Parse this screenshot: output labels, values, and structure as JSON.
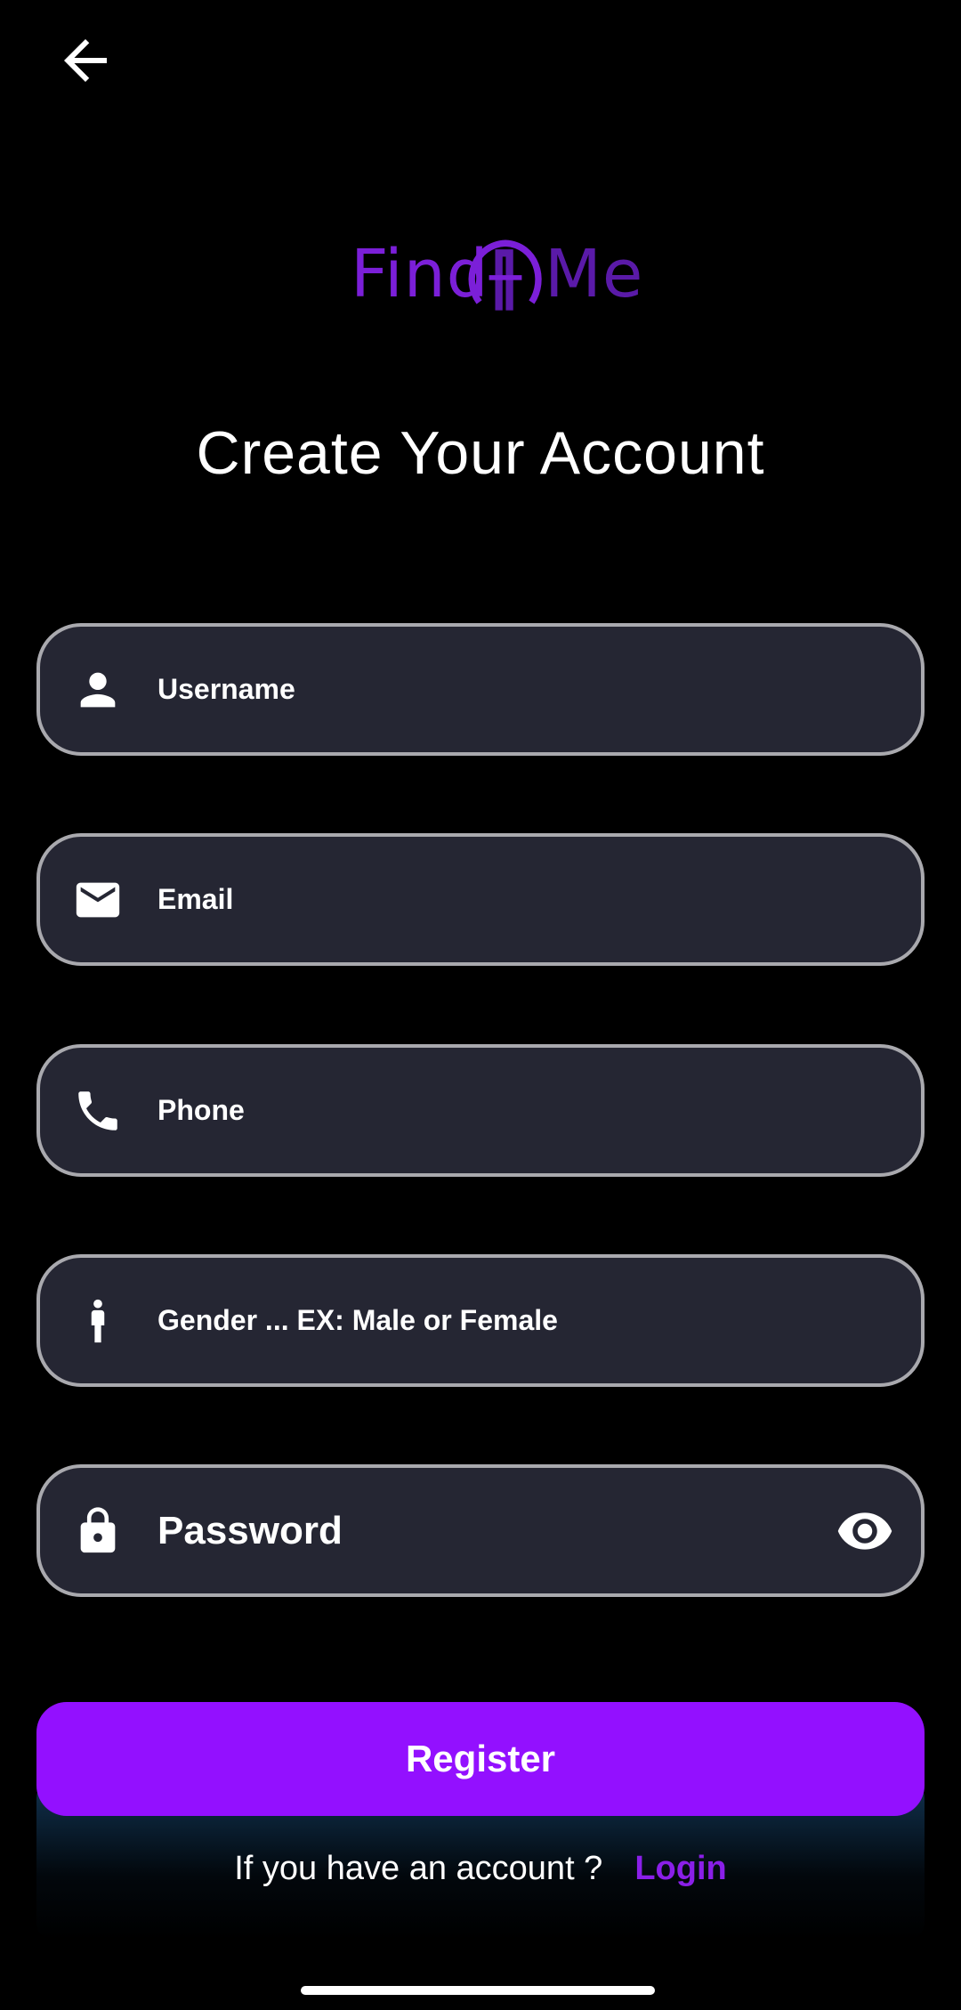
{
  "header": {
    "back_icon": "arrow-left-icon"
  },
  "logo": {
    "text_left": "Find",
    "text_right": "Me",
    "brand_color": "#7b1fd8"
  },
  "title": "Create Your Account",
  "form": {
    "username": {
      "placeholder": "Username",
      "icon": "person-icon"
    },
    "email": {
      "placeholder": "Email",
      "icon": "mail-icon"
    },
    "phone": {
      "placeholder": "Phone",
      "icon": "phone-icon"
    },
    "gender": {
      "placeholder": "Gender ... EX: Male or Female",
      "icon": "person-standing-icon"
    },
    "password": {
      "placeholder": "Password",
      "icon": "lock-icon",
      "toggle_icon": "eye-icon"
    }
  },
  "register_button": {
    "label": "Register",
    "color": "#9310ff"
  },
  "footer": {
    "prompt": "If you have an account ?",
    "login_label": "Login",
    "login_color": "#8a1fe8"
  },
  "colors": {
    "background": "#000000",
    "field_bg": "#252633",
    "field_border": "#a9a9ae"
  }
}
